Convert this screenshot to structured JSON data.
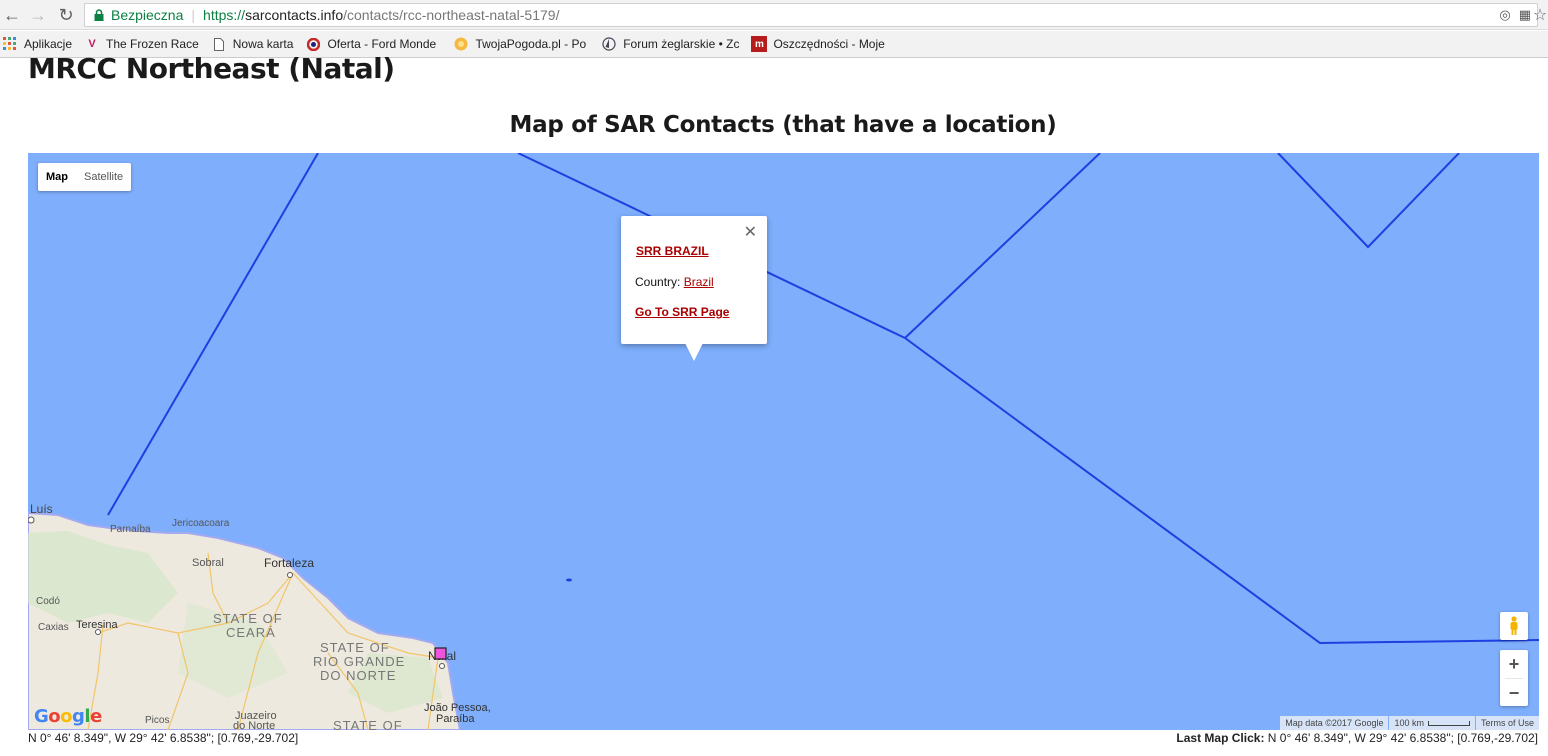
{
  "browser": {
    "secure_label": "Bezpieczna",
    "url_proto": "https://",
    "url_host": "sarcontacts.info",
    "url_path": "/contacts/rcc-northeast-natal-5179/"
  },
  "bookmarks": [
    {
      "label": "Aplikacje",
      "icon": "apps-grid-icon"
    },
    {
      "label": "The Frozen Race",
      "icon": "vr-logo-icon"
    },
    {
      "label": "Nowa karta",
      "icon": "page-icon"
    },
    {
      "label": "Oferta - Ford Monde",
      "icon": "ford-icon"
    },
    {
      "label": "TwojaPogoda.pl - Po",
      "icon": "sun-icon"
    },
    {
      "label": "Forum żeglarskie • Zc",
      "icon": "sail-icon"
    },
    {
      "label": "Oszczędności - Moje",
      "icon": "m-logo-icon"
    }
  ],
  "page": {
    "title": "MRCC Northeast (Natal)",
    "map_heading": "Map of SAR Contacts (that have a location)"
  },
  "map": {
    "type_controls": {
      "map": "Map",
      "satellite": "Satellite"
    },
    "infowindow": {
      "title": "SRR BRAZIL",
      "country_label": "Country:",
      "country_value": "Brazil",
      "link": "Go To SRR Page"
    },
    "labels": {
      "luis": "Luís",
      "parnaiba": "Parnaíba",
      "jericoacoara": "Jericoacoara",
      "sobral": "Sobral",
      "fortaleza": "Fortaleza",
      "state_ceara_1": "STATE OF",
      "state_ceara_2": "CEARÁ",
      "codo": "Codó",
      "caxias": "Caxias",
      "teresina": "Teresina",
      "state_rn_1": "STATE OF",
      "state_rn_2": "RIO GRANDE",
      "state_rn_3": "DO NORTE",
      "natal": "Natal",
      "joao_pessoa": "João Pessoa,",
      "paraiba": "Paraíba",
      "juazeiro_1": "Juazeiro",
      "juazeiro_2": "do Norte",
      "picos": "Picos",
      "state_bottom": "STATE OF"
    },
    "logo": "Google",
    "attribution": {
      "map_data": "Map data ©2017 Google",
      "scale": "100 km",
      "terms": "Terms of Use"
    },
    "colors": {
      "ocean": "#7eaefc",
      "srr_line": "#1f3fe0",
      "marker": "#ee55dd"
    }
  },
  "footer": {
    "coords": "N 0° 46' 8.349\", W 29° 42' 6.8538\"; [0.769,-29.702]",
    "last_click_label": "Last Map Click:",
    "last_click_value": " N 0° 46' 8.349\", W 29° 42' 6.8538\"; [0.769,-29.702]"
  }
}
